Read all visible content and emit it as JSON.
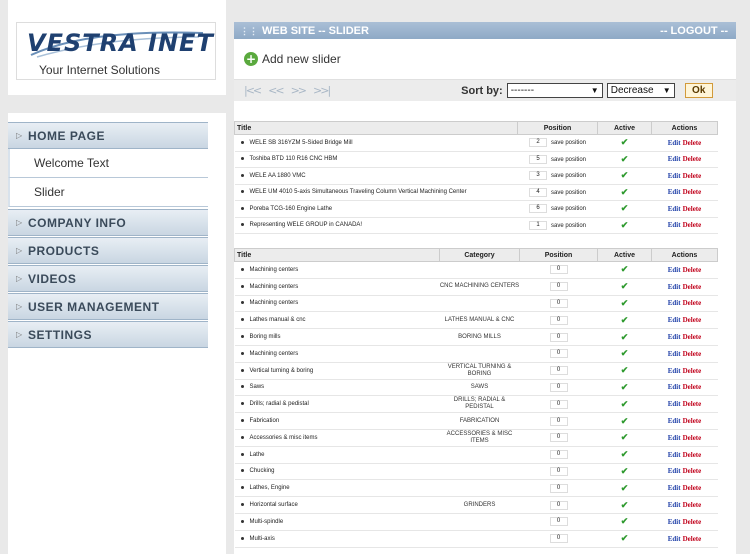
{
  "logo": {
    "name": "VESTRA INET",
    "tagline": "Your Internet Solutions"
  },
  "nav": [
    {
      "label": "HOME PAGE",
      "subitems": [
        "Welcome Text",
        "Slider"
      ]
    },
    {
      "label": "COMPANY INFO",
      "subitems": []
    },
    {
      "label": "PRODUCTS",
      "subitems": []
    },
    {
      "label": "VIDEOS",
      "subitems": []
    },
    {
      "label": "USER MANAGEMENT",
      "subitems": []
    },
    {
      "label": "SETTINGS",
      "subitems": []
    }
  ],
  "header": {
    "title": "WEB SITE -- SLIDER",
    "logout": "-- LOGOUT --"
  },
  "add_new": "Add new slider",
  "toolbar": {
    "pager": [
      "|<<",
      "<<",
      ">>",
      ">>|"
    ],
    "sort_label": "Sort by:",
    "sort_value": "-------",
    "order_value": "Decrease",
    "ok_label": "Ok"
  },
  "table1": {
    "headers": [
      "Title",
      "Position",
      "Active",
      "Actions"
    ],
    "save_label": "save position",
    "edit_label": "Edit",
    "delete_label": "Delete",
    "rows": [
      {
        "title": "WELE SB 316YZM 5-Sided Bridge Mill",
        "position": "2"
      },
      {
        "title": "Toshiba BTD 110 R16 CNC HBM",
        "position": "5"
      },
      {
        "title": "WELE AA 1880 VMC",
        "position": "3"
      },
      {
        "title": "WELE UM 4010 5-axis Simultaneous Traveling Column Vertical Machining Center",
        "position": "4"
      },
      {
        "title": "Poreba TCG-160 Engine Lathe",
        "position": "6"
      },
      {
        "title": "Representing WELE GROUP in CANADA!",
        "position": "1"
      }
    ]
  },
  "table2": {
    "headers": [
      "Title",
      "Category",
      "Position",
      "Active",
      "Actions"
    ],
    "edit_label": "Edit",
    "delete_label": "Delete",
    "rows": [
      {
        "title": "Machining centers",
        "category": "",
        "position": "0"
      },
      {
        "title": "Machining centers",
        "category": "CNC MACHINING CENTERS",
        "position": "0"
      },
      {
        "title": "Machining centers",
        "category": "",
        "position": "0"
      },
      {
        "title": "Lathes manual & cnc",
        "category": "LATHES MANUAL & CNC",
        "position": "0"
      },
      {
        "title": "Boring mills",
        "category": "BORING MILLS",
        "position": "0"
      },
      {
        "title": "Machining centers",
        "category": "",
        "position": "0"
      },
      {
        "title": "Vertical turning & boring",
        "category": "VERTICAL TURNING & BORING",
        "position": "0"
      },
      {
        "title": "Saws",
        "category": "SAWS",
        "position": "0"
      },
      {
        "title": "Drills; radial & pedistal",
        "category": "DRILLS; RADIAL & PEDISTAL",
        "position": "0"
      },
      {
        "title": "Fabrication",
        "category": "FABRICATION",
        "position": "0"
      },
      {
        "title": "Accessories & misc items",
        "category": "ACCESSORIES & MISC ITEMS",
        "position": "0"
      },
      {
        "title": "Lathe",
        "category": "",
        "position": "0"
      },
      {
        "title": "Chucking",
        "category": "",
        "position": "0"
      },
      {
        "title": "Lathes, Engine",
        "category": "",
        "position": "0"
      },
      {
        "title": "Horizontal surface",
        "category": "GRINDERS",
        "position": "0"
      },
      {
        "title": "Multi-spindle",
        "category": "",
        "position": "0"
      },
      {
        "title": "Multi-axis",
        "category": "",
        "position": "0"
      }
    ]
  },
  "colors": {
    "header_blue": "#8ea9c6",
    "edit": "#1f3fa8",
    "delete": "#c0001a",
    "check": "#2f9a2f"
  },
  "icons": {
    "add": "plus-circle-icon",
    "active": "check-icon",
    "nav": "triangle-right-icon"
  }
}
